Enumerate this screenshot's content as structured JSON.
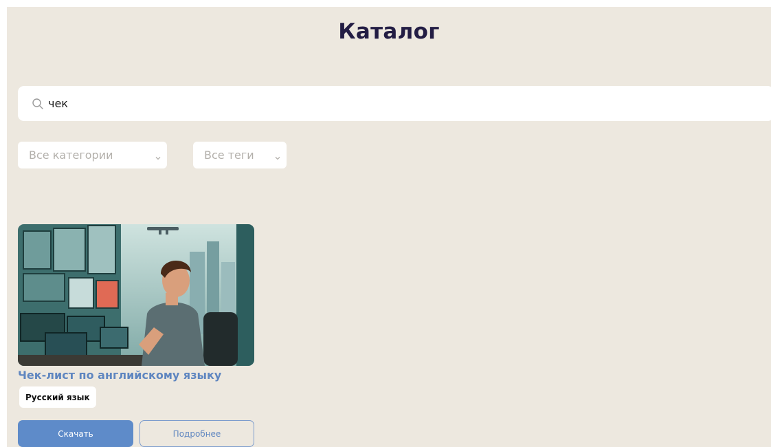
{
  "page": {
    "title": "Каталог"
  },
  "search": {
    "value": "чек",
    "icon": "search-icon"
  },
  "filters": {
    "category": {
      "selected": "Все категории",
      "icon": "chevron-down-icon"
    },
    "tags": {
      "selected": "Все теги",
      "icon": "chevron-down-icon"
    }
  },
  "cards": [
    {
      "image": "man-at-computer-monitors-city-illustration",
      "title": "Чек-лист по английскому языку",
      "tag": "Русский язык",
      "download_label": "Скачать",
      "details_label": "Подробнее"
    }
  ],
  "colors": {
    "background": "#ede8df",
    "title": "#231d44",
    "accent": "#5e8bc9",
    "card_title": "#5f86c0",
    "placeholder": "#b3b0ab"
  }
}
